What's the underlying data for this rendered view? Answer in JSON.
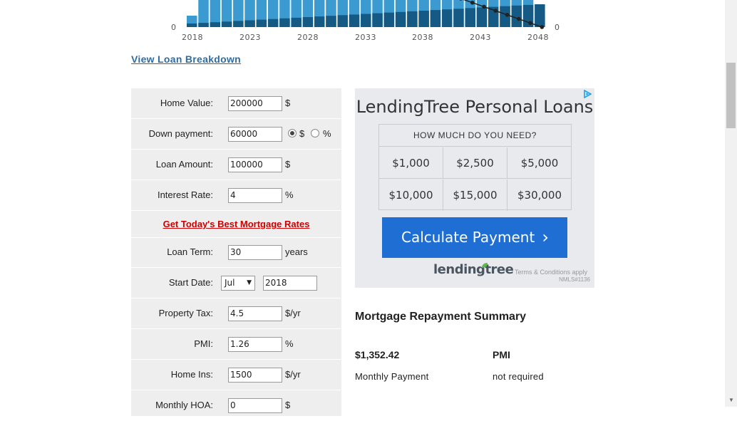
{
  "chart": {
    "y_left_zero": "0",
    "y_right_zero": "0",
    "x_ticks": [
      "2018",
      "2023",
      "2028",
      "2033",
      "2038",
      "2043",
      "2048"
    ],
    "colors": {
      "dark": "#155a84",
      "light": "#3b9ad0",
      "pale": "#9fd2ef",
      "line": "#222222"
    }
  },
  "breakdown_link": "View Loan Breakdown",
  "form": {
    "home_value": {
      "label": "Home Value:",
      "value": "200000",
      "unit": "$"
    },
    "down_payment": {
      "label": "Down payment:",
      "value": "60000",
      "unit_dollar": "$",
      "unit_percent": "%",
      "selected": "$"
    },
    "loan_amount": {
      "label": "Loan Amount:",
      "value": "100000",
      "unit": "$"
    },
    "interest_rate": {
      "label": "Interest Rate:",
      "value": "4",
      "unit": "%"
    },
    "rates_link": "Get Today's Best Mortgage Rates",
    "loan_term": {
      "label": "Loan Term:",
      "value": "30",
      "unit": "years"
    },
    "start_date": {
      "label": "Start Date:",
      "month": "Jul",
      "year": "2018"
    },
    "property_tax": {
      "label": "Property Tax:",
      "value": "4.5",
      "unit": "$/yr"
    },
    "pmi": {
      "label": "PMI:",
      "value": "1.26",
      "unit": "%"
    },
    "home_ins": {
      "label": "Home Ins:",
      "value": "1500",
      "unit": "$/yr"
    },
    "monthly_hoa": {
      "label": "Monthly HOA:",
      "value": "0",
      "unit": "$"
    }
  },
  "ad": {
    "title": "LendingTree Personal Loans",
    "question": "HOW MUCH DO YOU NEED?",
    "amounts": [
      "$1,000",
      "$2,500",
      "$5,000",
      "$10,000",
      "$15,000",
      "$30,000"
    ],
    "button": "Calculate Payment",
    "logo": "lendingtree",
    "terms": "Terms & Conditions apply",
    "nmls": "NMLS#1136",
    "button_color": "#1f6ed4"
  },
  "summary": {
    "title": "Mortgage Repayment Summary",
    "monthly_payment_value": "$1,352.42",
    "monthly_payment_label": "Monthly Payment",
    "pmi_value": "PMI",
    "pmi_label": "not required"
  }
}
